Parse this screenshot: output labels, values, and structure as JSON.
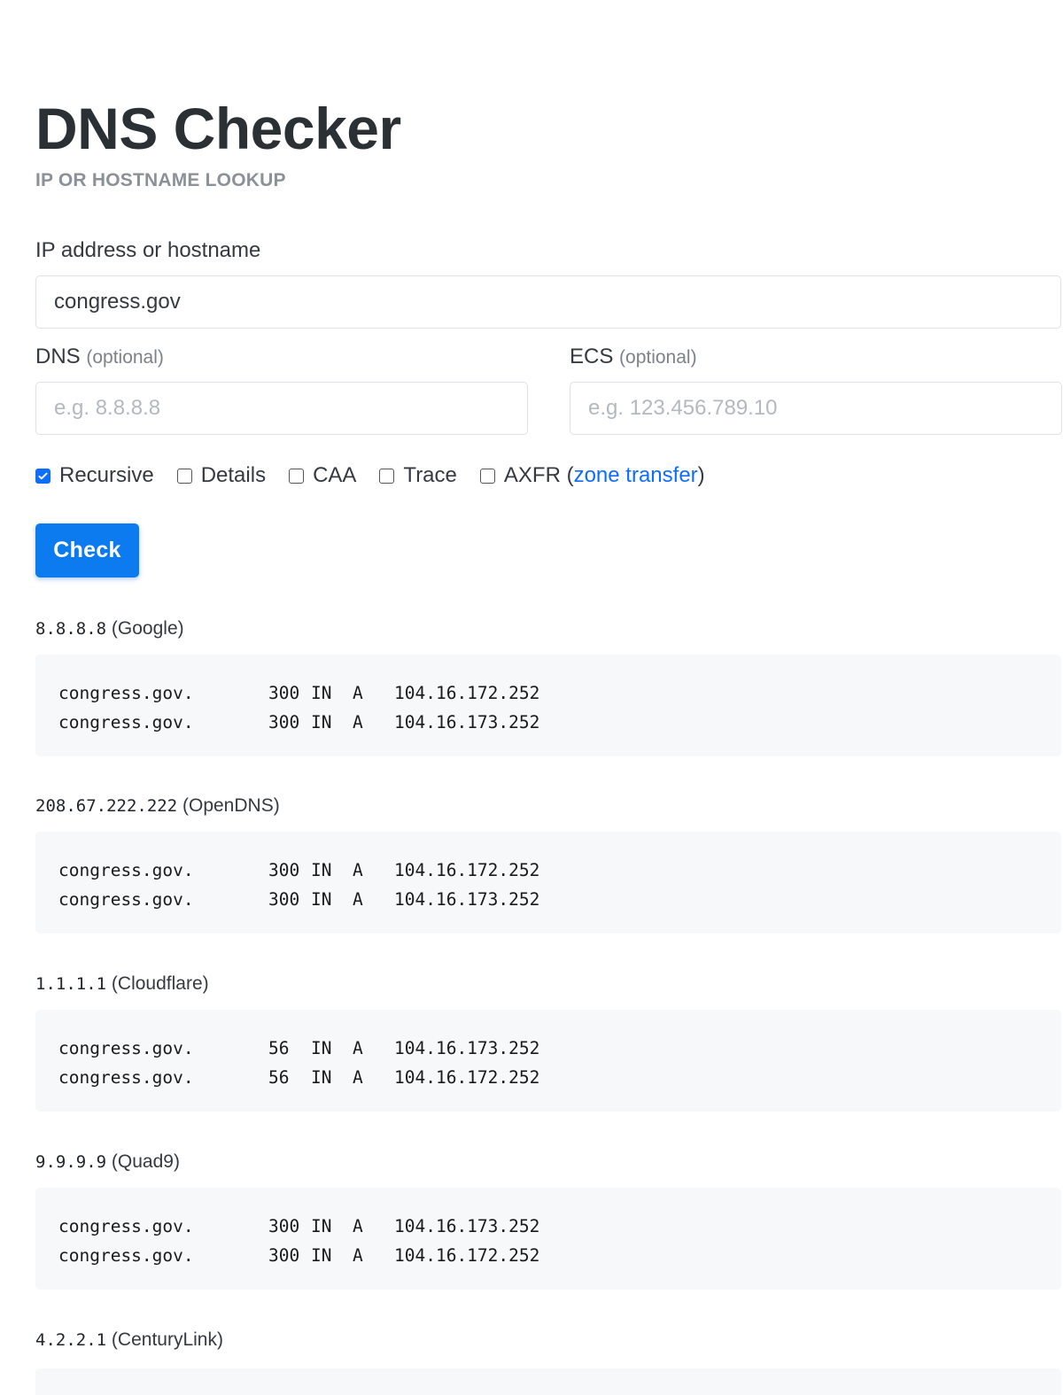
{
  "header": {
    "title": "DNS Checker",
    "subtitle": "IP OR HOSTNAME LOOKUP"
  },
  "form": {
    "host_label": "IP address or hostname",
    "host_value": "congress.gov",
    "dns_label": "DNS",
    "dns_optional": "(optional)",
    "dns_placeholder": "e.g. 8.8.8.8",
    "ecs_label": "ECS",
    "ecs_optional": "(optional)",
    "ecs_placeholder": "e.g. 123.456.789.10",
    "options": [
      {
        "label": "Recursive",
        "checked": true
      },
      {
        "label": "Details",
        "checked": false
      },
      {
        "label": "CAA",
        "checked": false
      },
      {
        "label": "Trace",
        "checked": false
      },
      {
        "label": "AXFR",
        "checked": false
      }
    ],
    "axfr_open": "(",
    "axfr_link": "zone transfer",
    "axfr_close": ")",
    "submit_label": "Check"
  },
  "results": [
    {
      "ip": "8.8.8.8",
      "provider": "(Google)",
      "records": [
        [
          "congress.gov.",
          "300",
          "IN",
          "A",
          "104.16.172.252"
        ],
        [
          "congress.gov.",
          "300",
          "IN",
          "A",
          "104.16.173.252"
        ]
      ]
    },
    {
      "ip": "208.67.222.222",
      "provider": "(OpenDNS)",
      "records": [
        [
          "congress.gov.",
          "300",
          "IN",
          "A",
          "104.16.172.252"
        ],
        [
          "congress.gov.",
          "300",
          "IN",
          "A",
          "104.16.173.252"
        ]
      ]
    },
    {
      "ip": "1.1.1.1",
      "provider": "(Cloudflare)",
      "records": [
        [
          "congress.gov.",
          "56",
          "IN",
          "A",
          "104.16.173.252"
        ],
        [
          "congress.gov.",
          "56",
          "IN",
          "A",
          "104.16.172.252"
        ]
      ]
    },
    {
      "ip": "9.9.9.9",
      "provider": "(Quad9)",
      "records": [
        [
          "congress.gov.",
          "300",
          "IN",
          "A",
          "104.16.173.252"
        ],
        [
          "congress.gov.",
          "300",
          "IN",
          "A",
          "104.16.172.252"
        ]
      ]
    },
    {
      "ip": "4.2.2.1",
      "provider": "(CenturyLink)",
      "records": []
    }
  ]
}
